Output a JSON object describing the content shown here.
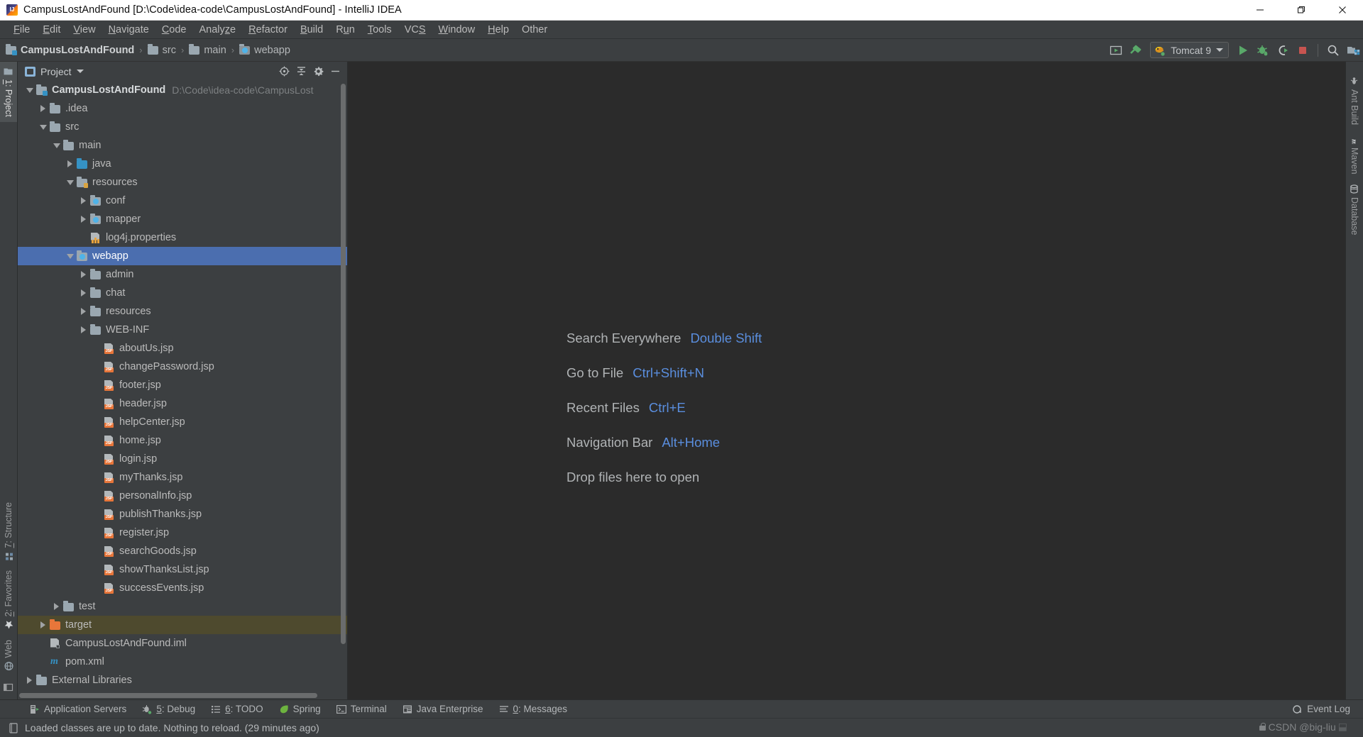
{
  "window": {
    "title": "CampusLostAndFound [D:\\Code\\idea-code\\CampusLostAndFound] - IntelliJ IDEA",
    "app_icon": "intellij-idea-icon",
    "controls": {
      "minimize": "minimize-icon",
      "maximize": "maximize-icon",
      "close": "close-icon"
    }
  },
  "menu": [
    {
      "label": "File",
      "mnemonic": "F"
    },
    {
      "label": "Edit",
      "mnemonic": "E"
    },
    {
      "label": "View",
      "mnemonic": "V"
    },
    {
      "label": "Navigate",
      "mnemonic": "N"
    },
    {
      "label": "Code",
      "mnemonic": "C"
    },
    {
      "label": "Analyze",
      "mnemonic": "z"
    },
    {
      "label": "Refactor",
      "mnemonic": "R"
    },
    {
      "label": "Build",
      "mnemonic": "B"
    },
    {
      "label": "Run",
      "mnemonic": "u"
    },
    {
      "label": "Tools",
      "mnemonic": "T"
    },
    {
      "label": "VCS",
      "mnemonic": "S"
    },
    {
      "label": "Window",
      "mnemonic": "W"
    },
    {
      "label": "Help",
      "mnemonic": "H"
    },
    {
      "label": "Other",
      "mnemonic": ""
    }
  ],
  "navbar": {
    "breadcrumbs": [
      {
        "label": "CampusLostAndFound",
        "icon": "module-folder-icon",
        "bold": true
      },
      {
        "label": "src",
        "icon": "folder-icon",
        "bold": false
      },
      {
        "label": "main",
        "icon": "folder-icon",
        "bold": false
      },
      {
        "label": "webapp",
        "icon": "web-folder-icon",
        "bold": false
      }
    ],
    "separator": "›",
    "actions": {
      "open_browser": "open-in-browser-icon",
      "build": "build-hammer-icon",
      "run_config_name": "Tomcat 9",
      "run_config_icon": "tomcat-icon",
      "run": "run-icon",
      "debug": "debug-icon",
      "run_coverage": "run-with-coverage-icon",
      "stop": "stop-icon",
      "search": "search-icon",
      "settings_group": "project-structure-icon"
    }
  },
  "left_stripe": [
    {
      "label": "1: Project",
      "mnemonic": "1",
      "icon": "project-folder-icon",
      "active": true
    },
    {
      "label": "7: Structure",
      "mnemonic": "7",
      "icon": "structure-icon",
      "active": false
    },
    {
      "label": "2: Favorites",
      "mnemonic": "2",
      "icon": "star-icon",
      "active": false
    },
    {
      "label": "Web",
      "mnemonic": "",
      "icon": "web-globe-icon",
      "active": false
    }
  ],
  "right_stripe": [
    {
      "label": "Ant Build",
      "icon": "ant-icon"
    },
    {
      "label": "Maven",
      "icon": "maven-m-icon"
    },
    {
      "label": "Database",
      "icon": "database-icon"
    }
  ],
  "project_panel": {
    "title": "Project",
    "title_icon": "project-view-icon",
    "dropdown_icon": "chevron-down-icon",
    "actions": [
      {
        "name": "locate-in-tree-icon"
      },
      {
        "name": "collapse-all-icon"
      },
      {
        "name": "gear-icon"
      },
      {
        "name": "hide-icon"
      }
    ],
    "tree": [
      {
        "label": "CampusLostAndFound",
        "sub": "D:\\Code\\idea-code\\CampusLost ",
        "depth": 0,
        "twisty": "down",
        "icon": "module-folder-icon",
        "bold": true,
        "state": "normal"
      },
      {
        "label": ".idea",
        "sub": "",
        "depth": 1,
        "twisty": "right",
        "icon": "folder-icon",
        "bold": false,
        "state": "normal"
      },
      {
        "label": "src",
        "sub": "",
        "depth": 1,
        "twisty": "down",
        "icon": "folder-icon",
        "bold": false,
        "state": "normal"
      },
      {
        "label": "main",
        "sub": "",
        "depth": 2,
        "twisty": "down",
        "icon": "folder-icon",
        "bold": false,
        "state": "normal"
      },
      {
        "label": "java",
        "sub": "",
        "depth": 3,
        "twisty": "right",
        "icon": "source-folder-icon",
        "bold": false,
        "state": "normal"
      },
      {
        "label": "resources",
        "sub": "",
        "depth": 3,
        "twisty": "down",
        "icon": "resources-folder-icon",
        "bold": false,
        "state": "normal"
      },
      {
        "label": "conf",
        "sub": "",
        "depth": 4,
        "twisty": "right",
        "icon": "web-folder-icon",
        "bold": false,
        "state": "normal"
      },
      {
        "label": "mapper",
        "sub": "",
        "depth": 4,
        "twisty": "right",
        "icon": "web-folder-icon",
        "bold": false,
        "state": "normal"
      },
      {
        "label": "log4j.properties",
        "sub": "",
        "depth": 4,
        "twisty": "none",
        "icon": "properties-file-icon",
        "bold": false,
        "state": "normal"
      },
      {
        "label": "webapp",
        "sub": "",
        "depth": 3,
        "twisty": "down",
        "icon": "web-folder-icon",
        "bold": false,
        "state": "selected"
      },
      {
        "label": "admin",
        "sub": "",
        "depth": 4,
        "twisty": "right",
        "icon": "folder-icon",
        "bold": false,
        "state": "normal"
      },
      {
        "label": "chat",
        "sub": "",
        "depth": 4,
        "twisty": "right",
        "icon": "folder-icon",
        "bold": false,
        "state": "normal"
      },
      {
        "label": "resources",
        "sub": "",
        "depth": 4,
        "twisty": "right",
        "icon": "folder-icon",
        "bold": false,
        "state": "normal"
      },
      {
        "label": "WEB-INF",
        "sub": "",
        "depth": 4,
        "twisty": "right",
        "icon": "folder-icon",
        "bold": false,
        "state": "normal"
      },
      {
        "label": "aboutUs.jsp",
        "sub": "",
        "depth": 5,
        "twisty": "none",
        "icon": "jsp-file-icon",
        "bold": false,
        "state": "normal"
      },
      {
        "label": "changePassword.jsp",
        "sub": "",
        "depth": 5,
        "twisty": "none",
        "icon": "jsp-file-icon",
        "bold": false,
        "state": "normal"
      },
      {
        "label": "footer.jsp",
        "sub": "",
        "depth": 5,
        "twisty": "none",
        "icon": "jsp-file-icon",
        "bold": false,
        "state": "normal"
      },
      {
        "label": "header.jsp",
        "sub": "",
        "depth": 5,
        "twisty": "none",
        "icon": "jsp-file-icon",
        "bold": false,
        "state": "normal"
      },
      {
        "label": "helpCenter.jsp",
        "sub": "",
        "depth": 5,
        "twisty": "none",
        "icon": "jsp-file-icon",
        "bold": false,
        "state": "normal"
      },
      {
        "label": "home.jsp",
        "sub": "",
        "depth": 5,
        "twisty": "none",
        "icon": "jsp-file-icon",
        "bold": false,
        "state": "normal"
      },
      {
        "label": "login.jsp",
        "sub": "",
        "depth": 5,
        "twisty": "none",
        "icon": "jsp-file-icon",
        "bold": false,
        "state": "normal"
      },
      {
        "label": "myThanks.jsp",
        "sub": "",
        "depth": 5,
        "twisty": "none",
        "icon": "jsp-file-icon",
        "bold": false,
        "state": "normal"
      },
      {
        "label": "personalInfo.jsp",
        "sub": "",
        "depth": 5,
        "twisty": "none",
        "icon": "jsp-file-icon",
        "bold": false,
        "state": "normal"
      },
      {
        "label": "publishThanks.jsp",
        "sub": "",
        "depth": 5,
        "twisty": "none",
        "icon": "jsp-file-icon",
        "bold": false,
        "state": "normal"
      },
      {
        "label": "register.jsp",
        "sub": "",
        "depth": 5,
        "twisty": "none",
        "icon": "jsp-file-icon",
        "bold": false,
        "state": "normal"
      },
      {
        "label": "searchGoods.jsp",
        "sub": "",
        "depth": 5,
        "twisty": "none",
        "icon": "jsp-file-icon",
        "bold": false,
        "state": "normal"
      },
      {
        "label": "showThanksList.jsp",
        "sub": "",
        "depth": 5,
        "twisty": "none",
        "icon": "jsp-file-icon",
        "bold": false,
        "state": "normal"
      },
      {
        "label": "successEvents.jsp",
        "sub": "",
        "depth": 5,
        "twisty": "none",
        "icon": "jsp-file-icon",
        "bold": false,
        "state": "normal"
      },
      {
        "label": "test",
        "sub": "",
        "depth": 2,
        "twisty": "right",
        "icon": "folder-icon",
        "bold": false,
        "state": "normal"
      },
      {
        "label": "target",
        "sub": "",
        "depth": 1,
        "twisty": "right",
        "icon": "excluded-folder-icon",
        "bold": false,
        "state": "highlighted"
      },
      {
        "label": "CampusLostAndFound.iml",
        "sub": "",
        "depth": 1,
        "twisty": "none",
        "icon": "iml-file-icon",
        "bold": false,
        "state": "normal"
      },
      {
        "label": "pom.xml",
        "sub": "",
        "depth": 1,
        "twisty": "none",
        "icon": "maven-pom-icon",
        "bold": false,
        "state": "normal"
      },
      {
        "label": "External Libraries",
        "sub": "",
        "depth": 0,
        "twisty": "right",
        "icon": "libraries-icon",
        "bold": false,
        "state": "normal"
      }
    ]
  },
  "editor": {
    "hints": [
      {
        "action": "Search Everywhere",
        "shortcut": "Double Shift"
      },
      {
        "action": "Go to File",
        "shortcut": "Ctrl+Shift+N"
      },
      {
        "action": "Recent Files",
        "shortcut": "Ctrl+E"
      },
      {
        "action": "Navigation Bar",
        "shortcut": "Alt+Home"
      },
      {
        "action": "Drop files here to open",
        "shortcut": ""
      }
    ]
  },
  "bottom_stripe": [
    {
      "label": "Application Servers",
      "mnemonic": "",
      "icon": "application-servers-icon"
    },
    {
      "label": "5: Debug",
      "mnemonic": "5",
      "icon": "debug-bug-icon"
    },
    {
      "label": "6: TODO",
      "mnemonic": "6",
      "icon": "todo-list-icon"
    },
    {
      "label": "Spring",
      "mnemonic": "",
      "icon": "spring-leaf-icon"
    },
    {
      "label": "Terminal",
      "mnemonic": "",
      "icon": "terminal-icon"
    },
    {
      "label": "Java Enterprise",
      "mnemonic": "",
      "icon": "java-enterprise-icon"
    },
    {
      "label": "0: Messages",
      "mnemonic": "0",
      "icon": "messages-icon"
    }
  ],
  "bottom_right": {
    "label": "Event Log",
    "icon": "event-log-icon"
  },
  "statusbar": {
    "icon": "status-info-icon",
    "message": "Loaded classes are up to date. Nothing to reload. (29 minutes ago)",
    "watermark": "CSDN @big-liu"
  },
  "colors": {
    "accent_blue": "#4b6eaf",
    "link_blue": "#5a8ede",
    "panel_bg": "#3c3f41",
    "editor_bg": "#2b2b2b",
    "highlight_olive": "#4e4a2e",
    "orange": "#e8763a"
  }
}
